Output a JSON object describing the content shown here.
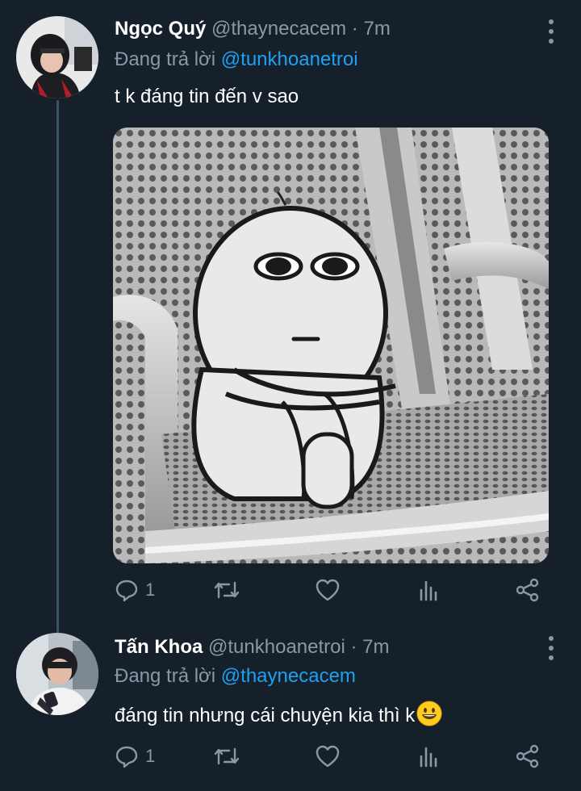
{
  "tweets": [
    {
      "name": "Ngọc Quý",
      "handle": "@thaynecacem",
      "separator": "·",
      "time": "7m",
      "reply_prefix": "Đang trả lời",
      "reply_to": "@tunkhoanetroi",
      "text": "t k đáng tin đến v sao",
      "reply_count": "1"
    },
    {
      "name": "Tấn Khoa",
      "handle": "@tunkhoanetroi",
      "separator": "·",
      "time": "7m",
      "reply_prefix": "Đang trả lời",
      "reply_to": "@thaynecacem",
      "text": "đáng tin nhưng cái chuyện kia thì k",
      "reply_count": "1"
    }
  ],
  "colors": {
    "background": "#15202b",
    "secondary_text": "#8899a6",
    "accent": "#1da1f2",
    "thread_line": "#3d5466"
  },
  "icons": [
    "more-vertical-icon",
    "reply-icon",
    "retweet-icon",
    "like-icon",
    "analytics-icon",
    "share-icon",
    "grinning-face-emoji"
  ]
}
